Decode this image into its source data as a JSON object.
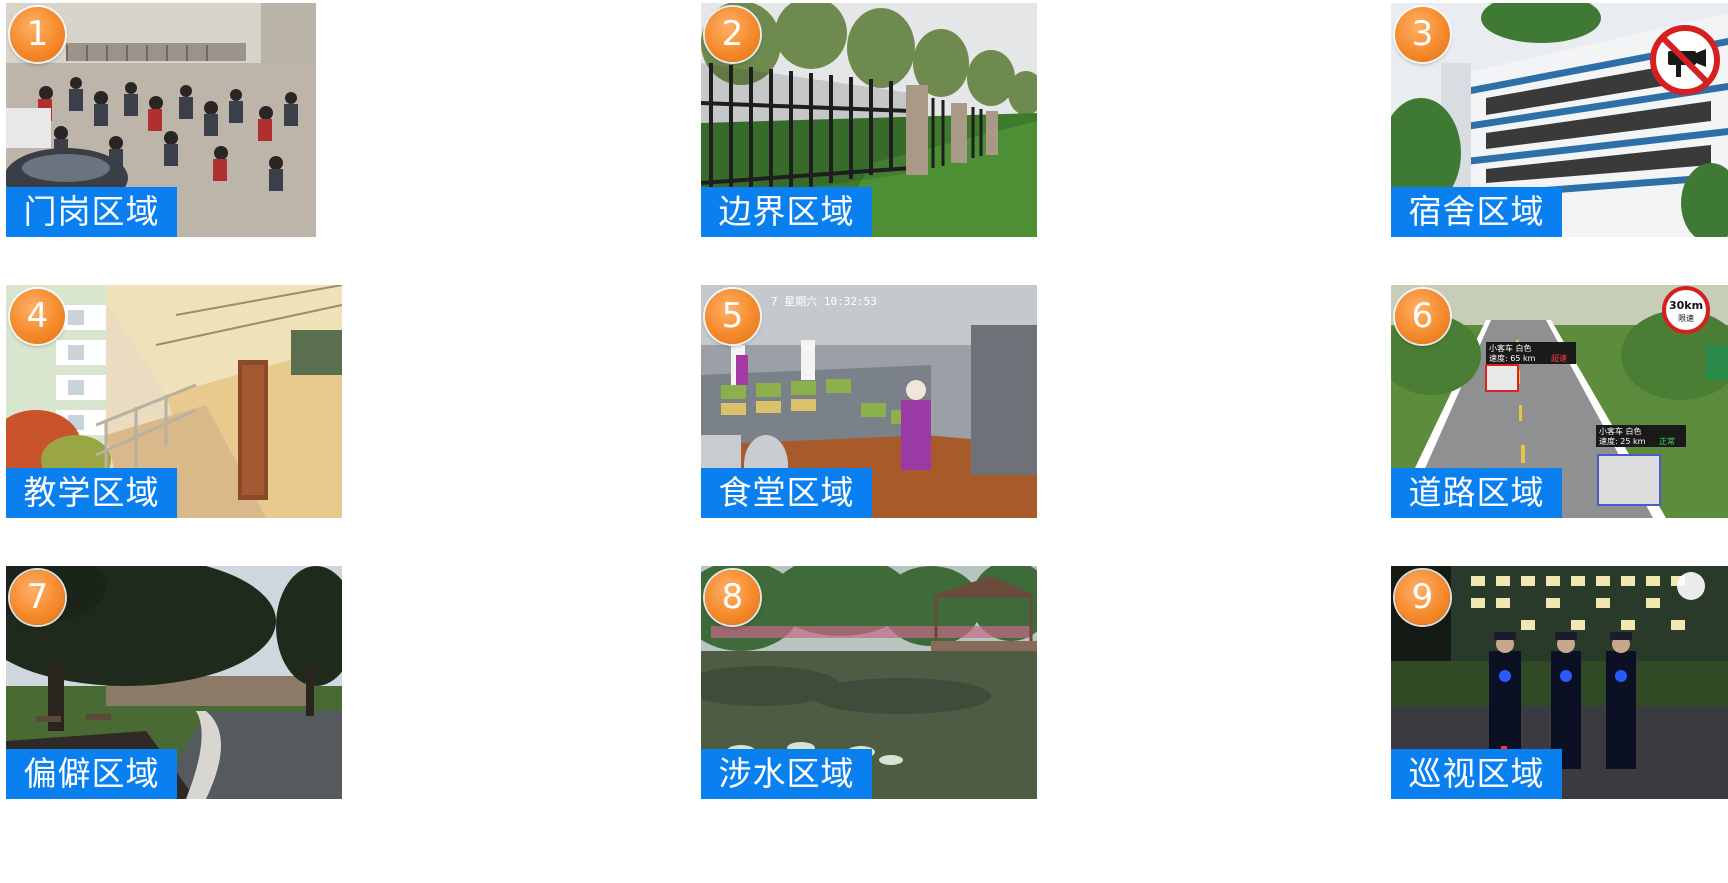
{
  "areas": [
    {
      "number": "1",
      "label": "门岗区域"
    },
    {
      "number": "2",
      "label": "边界区域"
    },
    {
      "number": "3",
      "label": "宿舍区域"
    },
    {
      "number": "4",
      "label": "教学区域"
    },
    {
      "number": "5",
      "label": "食堂区域"
    },
    {
      "number": "6",
      "label": "道路区域"
    },
    {
      "number": "7",
      "label": "偏僻区域"
    },
    {
      "number": "8",
      "label": "涉水区域"
    },
    {
      "number": "9",
      "label": "巡视区域"
    }
  ],
  "overlays": {
    "speed_sign": "30km",
    "speed_sign_sub": "限速",
    "car1_line1": "小客车 白色",
    "car1_line2": "速度: 65 km",
    "car1_flag": "超速",
    "car2_line1": "小客车 白色",
    "car2_line2": "速度: 25 km",
    "car2_flag": "正常",
    "kitchen_timestamp": "7 星期六 10:32:53"
  },
  "colors": {
    "label_bg": "#0a7ff0",
    "badge": "#f58a2c"
  },
  "icons": [
    "no-camera-sign-icon"
  ]
}
